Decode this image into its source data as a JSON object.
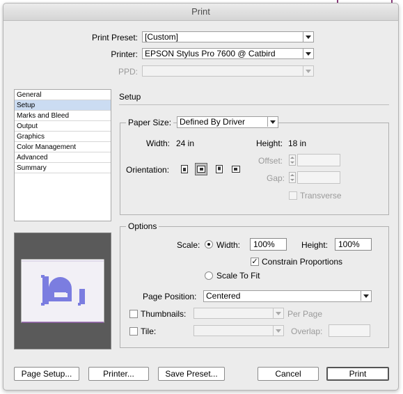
{
  "window": {
    "title": "Print"
  },
  "header": {
    "print_preset_label": "Print Preset:",
    "print_preset_value": "[Custom]",
    "printer_label": "Printer:",
    "printer_value": "EPSON Stylus Pro 7600 @ Catbird",
    "ppd_label": "PPD:",
    "ppd_value": ""
  },
  "sidebar": {
    "items": [
      {
        "label": "General"
      },
      {
        "label": "Setup"
      },
      {
        "label": "Marks and Bleed"
      },
      {
        "label": "Output"
      },
      {
        "label": "Graphics"
      },
      {
        "label": "Color Management"
      },
      {
        "label": "Advanced"
      },
      {
        "label": "Summary"
      }
    ],
    "selected": "Setup"
  },
  "setup": {
    "title": "Setup",
    "paper_size_label": "Paper Size:",
    "paper_size_value": "Defined By Driver",
    "width_label": "Width:",
    "width_value": "24 in",
    "height_label": "Height:",
    "height_value": "18 in",
    "orientation_label": "Orientation:",
    "orientation_selected": "reverse-landscape",
    "offset_label": "Offset:",
    "offset_value": "",
    "gap_label": "Gap:",
    "gap_value": "",
    "transverse_label": "Transverse",
    "transverse_checked": false
  },
  "options": {
    "title": "Options",
    "scale_label": "Scale:",
    "width_label": "Width:",
    "width_value": "100%",
    "height_label": "Height:",
    "height_value": "100%",
    "constrain_label": "Constrain Proportions",
    "constrain_checked": true,
    "scale_to_fit_label": "Scale To Fit",
    "page_position_label": "Page Position:",
    "page_position_value": "Centered",
    "thumbnails_label": "Thumbnails:",
    "thumbnails_value": "",
    "per_page_label": "Per Page",
    "tile_label": "Tile:",
    "tile_value": "",
    "overlap_label": "Overlap:",
    "overlap_value": ""
  },
  "preview": {
    "glyph": "P",
    "colors": {
      "background": "#5a5a5a",
      "page": "#f2f0f6",
      "glyph": "#7b7de0",
      "edge": "#8e5ca8"
    }
  },
  "buttons": {
    "page_setup": "Page Setup...",
    "printer": "Printer...",
    "save_preset": "Save Preset...",
    "cancel": "Cancel",
    "print": "Print"
  }
}
